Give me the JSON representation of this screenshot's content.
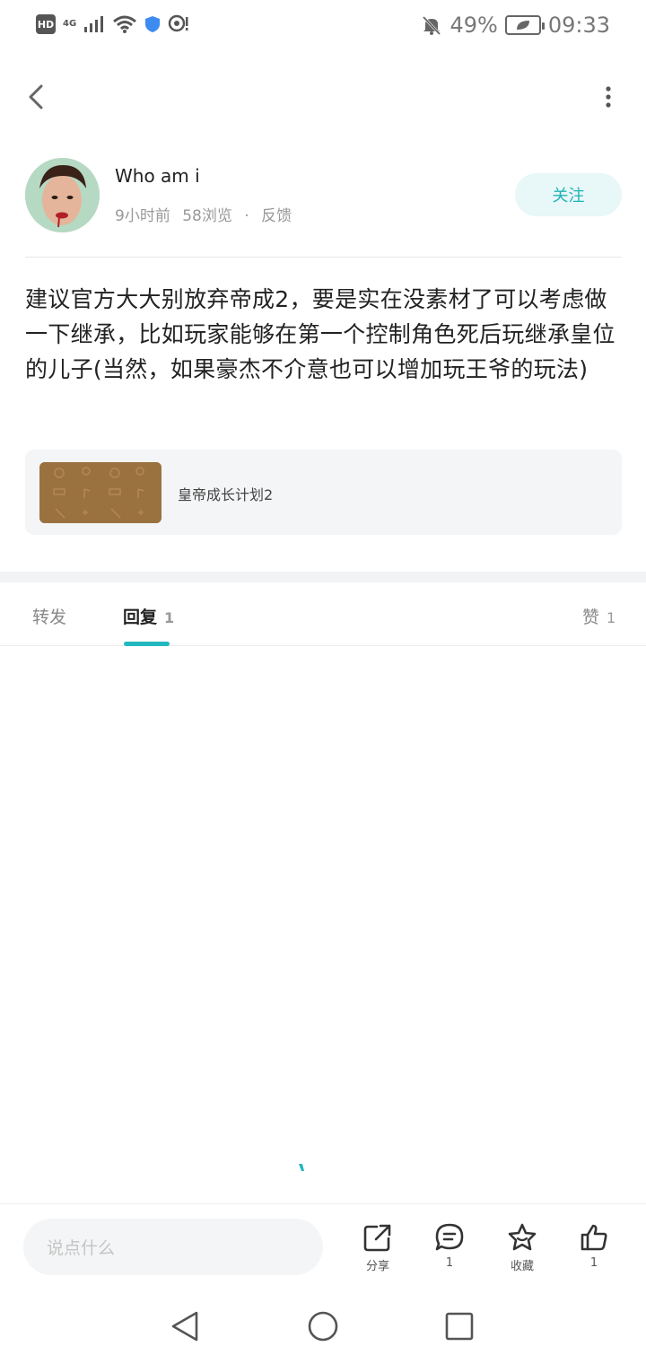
{
  "status_bar": {
    "hd": "HD",
    "network": "4G",
    "battery": "49%",
    "time": "09:33"
  },
  "header": {
    "back_icon": "chevron-left-icon",
    "more_icon": "more-vertical-icon"
  },
  "author": {
    "name": "Who am i",
    "time_ago": "9小时前",
    "views": "58浏览",
    "separator": "·",
    "feedback": "反馈",
    "follow_label": "关注"
  },
  "post": {
    "text": "建议官方大大别放弃帝成2，要是实在没素材了可以考虑做一下继承，比如玩家能够在第一个控制角色死后玩继承皇位的儿子(当然，如果豪杰不介意也可以增加玩王爷的玩法)"
  },
  "game_card": {
    "title": "皇帝成长计划2"
  },
  "tabs": {
    "repost": {
      "label": "转发"
    },
    "reply": {
      "label": "回复",
      "count": "1"
    },
    "like": {
      "label": "赞",
      "count": "1"
    }
  },
  "action_bar": {
    "input_placeholder": "说点什么",
    "share_label": "分享",
    "comment_count": "1",
    "favorite_label": "收藏",
    "like_count": "1"
  },
  "colors": {
    "accent": "#22b8c0",
    "follow_bg": "#e8f7f7",
    "card_bg": "#f4f5f6"
  }
}
